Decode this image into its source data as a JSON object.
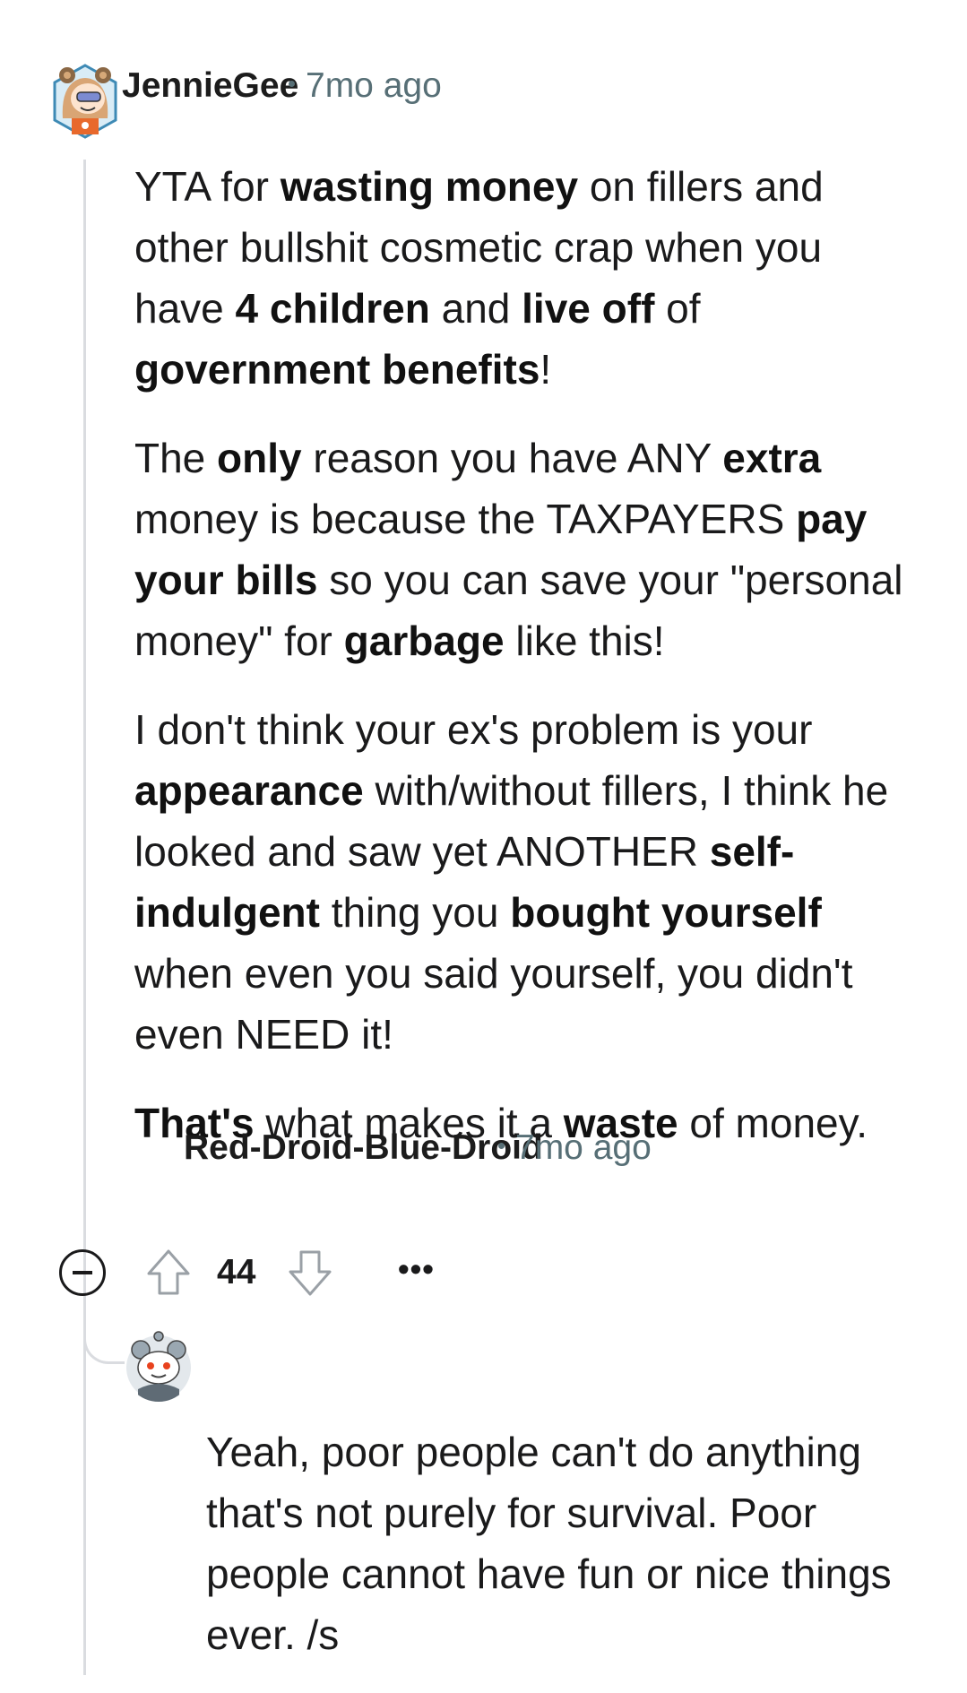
{
  "comment": {
    "author": "JennieGee",
    "time": "7mo ago",
    "avatar_icon": "snoo-avatar-bear-icon",
    "score": "44",
    "more_label": "•••",
    "paragraphs": [
      [
        {
          "t": "YTA for "
        },
        {
          "t": "wasting money",
          "b": true
        },
        {
          "t": " on fillers and other bullshit cosmetic crap when you have "
        },
        {
          "t": "4 children",
          "b": true
        },
        {
          "t": " and "
        },
        {
          "t": "live off",
          "b": true
        },
        {
          "t": " of "
        },
        {
          "t": "government benefits",
          "b": true
        },
        {
          "t": "!"
        }
      ],
      [
        {
          "t": "The "
        },
        {
          "t": "only",
          "b": true
        },
        {
          "t": " reason you have ANY "
        },
        {
          "t": "extra",
          "b": true
        },
        {
          "t": " money is because the TAXPAYERS "
        },
        {
          "t": "pay your bills",
          "b": true
        },
        {
          "t": " so you can save your \"personal money\" for "
        },
        {
          "t": "garbage",
          "b": true
        },
        {
          "t": " like this!"
        }
      ],
      [
        {
          "t": "I don't think your ex's problem is your "
        },
        {
          "t": "appearance",
          "b": true
        },
        {
          "t": " with/without fillers, I think he looked and saw yet ANOTHER "
        },
        {
          "t": "self-indulgent",
          "b": true
        },
        {
          "t": " thing you "
        },
        {
          "t": "bought yourself",
          "b": true
        },
        {
          "t": " when even you said yourself, you didn't even NEED it!"
        }
      ],
      [
        {
          "t": "That's",
          "b": true
        },
        {
          "t": " what makes it a "
        },
        {
          "t": "waste",
          "b": true
        },
        {
          "t": " of money."
        }
      ]
    ]
  },
  "reply": {
    "author": "Red-Droid-Blue-Droid",
    "time": "7mo ago",
    "avatar_icon": "snoo-avatar-robot-icon",
    "paragraphs": [
      [
        {
          "t": "Yeah, poor people can't do anything that's not purely for survival. Poor people cannot have fun or nice things ever. /s"
        }
      ]
    ]
  },
  "colors": {
    "text": "#1a1a1b",
    "meta": "#576f76",
    "thread_line": "#dadce0",
    "vote_outline": "#9aa0a6"
  }
}
